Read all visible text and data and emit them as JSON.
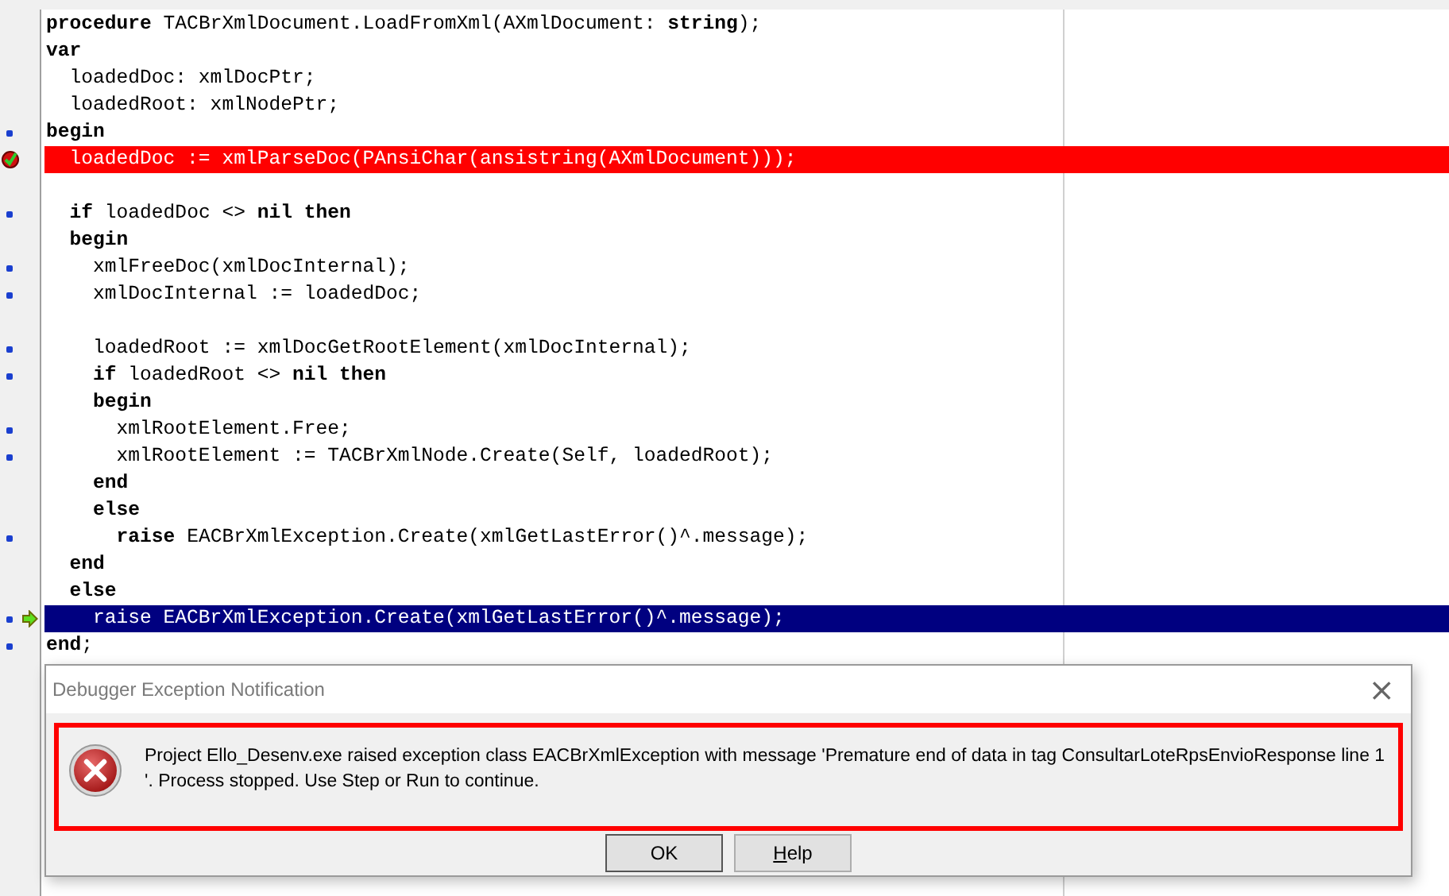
{
  "editor": {
    "lines": [
      {
        "kind": "code",
        "dot": false,
        "text": "**procedure** TACBrXmlDocument.LoadFromXml(AXmlDocument: **string**);"
      },
      {
        "kind": "code",
        "dot": false,
        "text": "**var**"
      },
      {
        "kind": "code",
        "dot": false,
        "text": "  loadedDoc: xmlDocPtr;"
      },
      {
        "kind": "code",
        "dot": false,
        "text": "  loadedRoot: xmlNodePtr;"
      },
      {
        "kind": "code",
        "dot": true,
        "text": "**begin**"
      },
      {
        "kind": "error-line",
        "dot": false,
        "text": "  loadedDoc := xmlParseDoc(PAnsiChar(ansistring(AXmlDocument)));"
      },
      {
        "kind": "blank",
        "dot": false
      },
      {
        "kind": "code",
        "dot": true,
        "text": "  **if** loadedDoc <> **nil** **then**"
      },
      {
        "kind": "code",
        "dot": false,
        "text": "  **begin**"
      },
      {
        "kind": "code",
        "dot": true,
        "text": "    xmlFreeDoc(xmlDocInternal);"
      },
      {
        "kind": "code",
        "dot": true,
        "text": "    xmlDocInternal := loadedDoc;"
      },
      {
        "kind": "blank",
        "dot": false
      },
      {
        "kind": "code",
        "dot": true,
        "text": "    loadedRoot := xmlDocGetRootElement(xmlDocInternal);"
      },
      {
        "kind": "code",
        "dot": true,
        "text": "    **if** loadedRoot <> **nil** **then**"
      },
      {
        "kind": "code",
        "dot": false,
        "text": "    **begin**"
      },
      {
        "kind": "code",
        "dot": true,
        "text": "      xmlRootElement.Free;"
      },
      {
        "kind": "code",
        "dot": true,
        "text": "      xmlRootElement := TACBrXmlNode.Create(Self, loadedRoot);"
      },
      {
        "kind": "code",
        "dot": false,
        "text": "    **end**"
      },
      {
        "kind": "code",
        "dot": false,
        "text": "    **else**"
      },
      {
        "kind": "code",
        "dot": true,
        "text": "      **raise** EACBrXmlException.Create(xmlGetLastError()^.message);"
      },
      {
        "kind": "code",
        "dot": false,
        "text": "  **end**"
      },
      {
        "kind": "code",
        "dot": false,
        "text": "  **else**"
      },
      {
        "kind": "execution-line",
        "dot": true,
        "text": "    raise EACBrXmlException.Create(xmlGetLastError()^.message);"
      },
      {
        "kind": "code",
        "dot": true,
        "text": "**end**;"
      }
    ]
  },
  "dialog": {
    "title": "Debugger Exception Notification",
    "close": "×",
    "message": "Project Ello_Desenv.exe raised exception class EACBrXmlException with message 'Premature end of data in tag ConsultarLoteRpsEnvioResponse line 1 '. Process stopped. Use Step or Run to continue.",
    "buttons": [
      "OK",
      "Help"
    ]
  }
}
